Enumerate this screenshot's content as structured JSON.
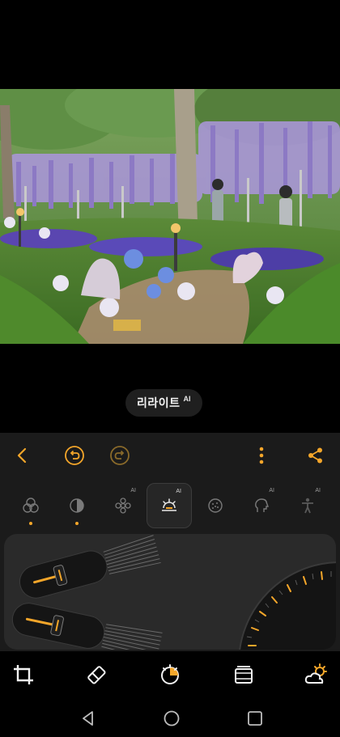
{
  "badge": {
    "name": "리라이트",
    "ai": "AI"
  },
  "toolbar": {
    "back_icon": "chevron-left-icon",
    "undo_icon": "undo-icon",
    "redo_icon": "redo-icon",
    "more_icon": "more-vertical-icon",
    "share_icon": "share-icon"
  },
  "tools": [
    {
      "icon": "color-circles-icon",
      "ai": "",
      "dot": true
    },
    {
      "icon": "tone-circle-icon",
      "ai": "",
      "dot": true
    },
    {
      "icon": "flower-icon",
      "ai": "AI",
      "dot": false
    },
    {
      "icon": "relight-sun-icon",
      "ai": "AI",
      "dot": false,
      "active": true
    },
    {
      "icon": "dotted-circle-icon",
      "ai": "",
      "dot": false
    },
    {
      "icon": "face-icon",
      "ai": "AI",
      "dot": false
    },
    {
      "icon": "person-icon",
      "ai": "AI",
      "dot": false
    }
  ],
  "nav": {
    "crop_icon": "crop-icon",
    "eraser_icon": "eraser-icon",
    "adjust_icon": "adjust-dial-icon",
    "filter_icon": "film-icon",
    "weather_icon": "weather-icon"
  },
  "colors": {
    "accent": "#f4a62a",
    "panel": "#1b1b1b"
  }
}
